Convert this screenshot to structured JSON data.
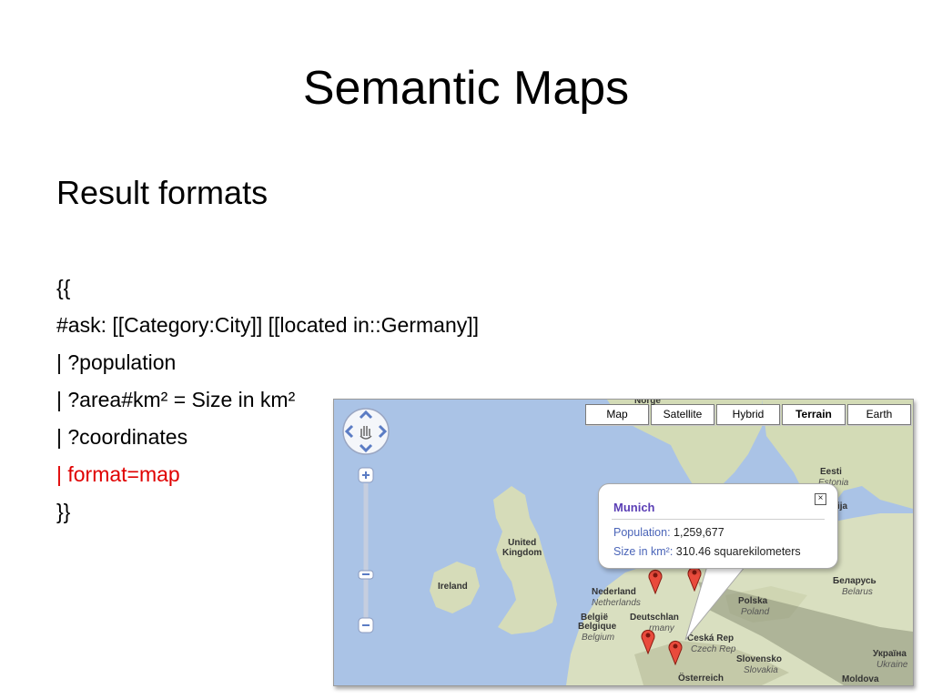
{
  "slide": {
    "title": "Semantic Maps",
    "subtitle": "Result formats",
    "code_lines": [
      "{{",
      "#ask: [[Category:City]] [[located in::Germany]]",
      "| ?population",
      "| ?area#km² = Size in km²",
      "| ?coordinates",
      "| format=map",
      "}}"
    ],
    "highlight_color": "#e00000"
  },
  "map": {
    "types": [
      "Map",
      "Satellite",
      "Hybrid",
      "Terrain",
      "Earth"
    ],
    "active_type": "Terrain",
    "balloon": {
      "title": "Munich",
      "close": "×",
      "population_label": "Population:",
      "population_value": "1,259,677",
      "size_label": "Size in km²:",
      "size_value": "310.46 squarekilometers"
    },
    "labels": {
      "uk_1": "United",
      "uk_2": "Kingdom",
      "ireland": "Ireland",
      "nederland": "Nederland",
      "netherlands": "Netherlands",
      "belgie": "België",
      "belgique": "Belgique",
      "belgium": "Belgium",
      "deutschland": "Deutschlan",
      "germany": "rmany",
      "polska": "Polska",
      "poland": "Poland",
      "ceska": "Česká Rep",
      "czech": "Czech Rep",
      "belarus_local": "Беларусь",
      "belarus": "Belarus",
      "eesti": "Eesti",
      "estonia": "Estonia",
      "latvija": "ija",
      "slovensko": "Slovensko",
      "slovakia": "Slovakia",
      "osterreich": "Österreich",
      "moldova": "Moldova",
      "ukraina": "Україна",
      "ukraine": "Ukraine",
      "norge": "Norge"
    },
    "colors": {
      "water": "#aac3e6",
      "land": "#d9dfc0",
      "pin": "#e94b3c"
    }
  }
}
